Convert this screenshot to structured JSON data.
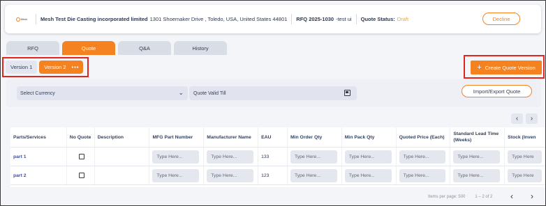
{
  "header": {
    "logo_text": "Mesh",
    "company": "Mesh Test Die Casting incorporated limited",
    "address": "1301 Shoemaker Drive , Toledo, USA, United States 44801",
    "rfq": "RFQ 2025-1030",
    "rfq_extra": "-test ui",
    "quote_status_label": "Quote Status:",
    "quote_status_value": "Draft",
    "decline_label": "Decline"
  },
  "tabs": [
    "RFQ",
    "Quote",
    "Q&A",
    "History"
  ],
  "active_tab": "Quote",
  "versions": {
    "items": [
      "Version 1",
      "Version 2"
    ],
    "active": "Version 2",
    "more": "•••"
  },
  "create_quote_version": "Create Quote Version",
  "filters": {
    "currency_placeholder": "Select Currency",
    "valid_till_placeholder": "Quote Valid Till",
    "import_export": "Import/Export Quote"
  },
  "table": {
    "columns": [
      "Parts/Services",
      "No Quote",
      "Description",
      "MFG Part Number",
      "Manufacturer Name",
      "EAU",
      "Min Order Qty",
      "Min Pack Qty",
      "Quoted Price (Each)",
      "Standard Lead Time (Weeks)",
      "Stock (Inven"
    ],
    "rows": [
      {
        "part": "part 1",
        "eau": "133"
      },
      {
        "part": "part 2",
        "eau": "123"
      }
    ],
    "input_placeholder": "Type Here...",
    "input_placeholder_cut": "Type Here"
  },
  "pagination": {
    "items_per_page": "Items per page: 500",
    "range": "1 – 2 of 2"
  },
  "colors": {
    "accent": "#f58220",
    "highlight_border": "#e0241f",
    "draft": "#f5a623"
  }
}
